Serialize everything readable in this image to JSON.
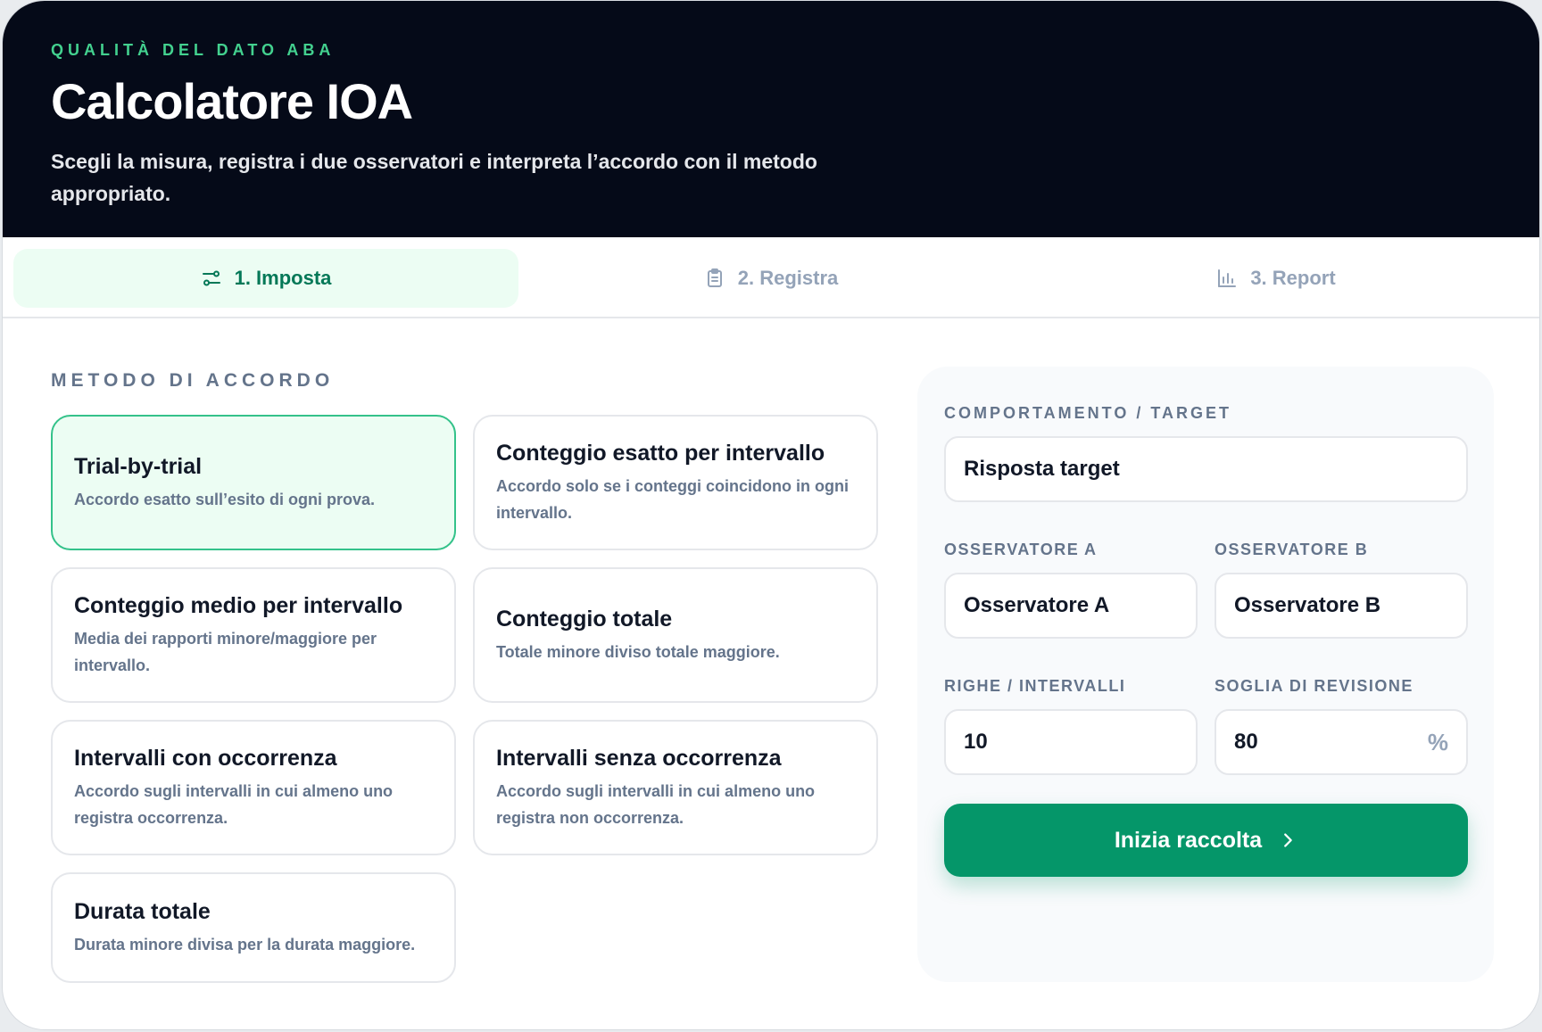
{
  "header": {
    "eyebrow": "QUALITÀ DEL DATO ABA",
    "title": "Calcolatore IOA",
    "subtitle": "Scegli la misura, registra i due osservatori e interpreta l’accordo con il metodo appropriato."
  },
  "tabs": [
    {
      "label": "1. Imposta",
      "icon": "sliders-icon",
      "active": true
    },
    {
      "label": "2. Registra",
      "icon": "clipboard-icon",
      "active": false
    },
    {
      "label": "3. Report",
      "icon": "bar-chart-icon",
      "active": false
    }
  ],
  "methods": {
    "section_label": "METODO DI ACCORDO",
    "items": [
      {
        "title": "Trial-by-trial",
        "desc": "Accordo esatto sull’esito di ogni prova.",
        "selected": true
      },
      {
        "title": "Conteggio esatto per intervallo",
        "desc": "Accordo solo se i conteggi coincidono in ogni intervallo."
      },
      {
        "title": "Conteggio medio per intervallo",
        "desc": "Media dei rapporti minore/maggiore per intervallo."
      },
      {
        "title": "Conteggio totale",
        "desc": "Totale minore diviso totale maggiore."
      },
      {
        "title": "Intervalli con occorrenza",
        "desc": "Accordo sugli intervalli in cui almeno uno registra occorrenza."
      },
      {
        "title": "Intervalli senza occorrenza",
        "desc": "Accordo sugli intervalli in cui almeno uno registra non occorrenza."
      },
      {
        "title": "Durata totale",
        "desc": "Durata minore divisa per la durata maggiore."
      }
    ]
  },
  "form": {
    "target_label": "COMPORTAMENTO / TARGET",
    "target_value": "Risposta target",
    "observer_a_label": "OSSERVATORE A",
    "observer_a_value": "Osservatore A",
    "observer_b_label": "OSSERVATORE B",
    "observer_b_value": "Osservatore B",
    "rows_label": "RIGHE / INTERVALLI",
    "rows_value": "10",
    "threshold_label": "SOGLIA DI REVISIONE",
    "threshold_value": "80",
    "threshold_suffix": "%",
    "submit_label": "Inizia raccolta"
  },
  "colors": {
    "accent": "#059669",
    "accent_light": "#ecfdf3",
    "header_bg": "#050a18",
    "eyebrow": "#43d18f"
  }
}
